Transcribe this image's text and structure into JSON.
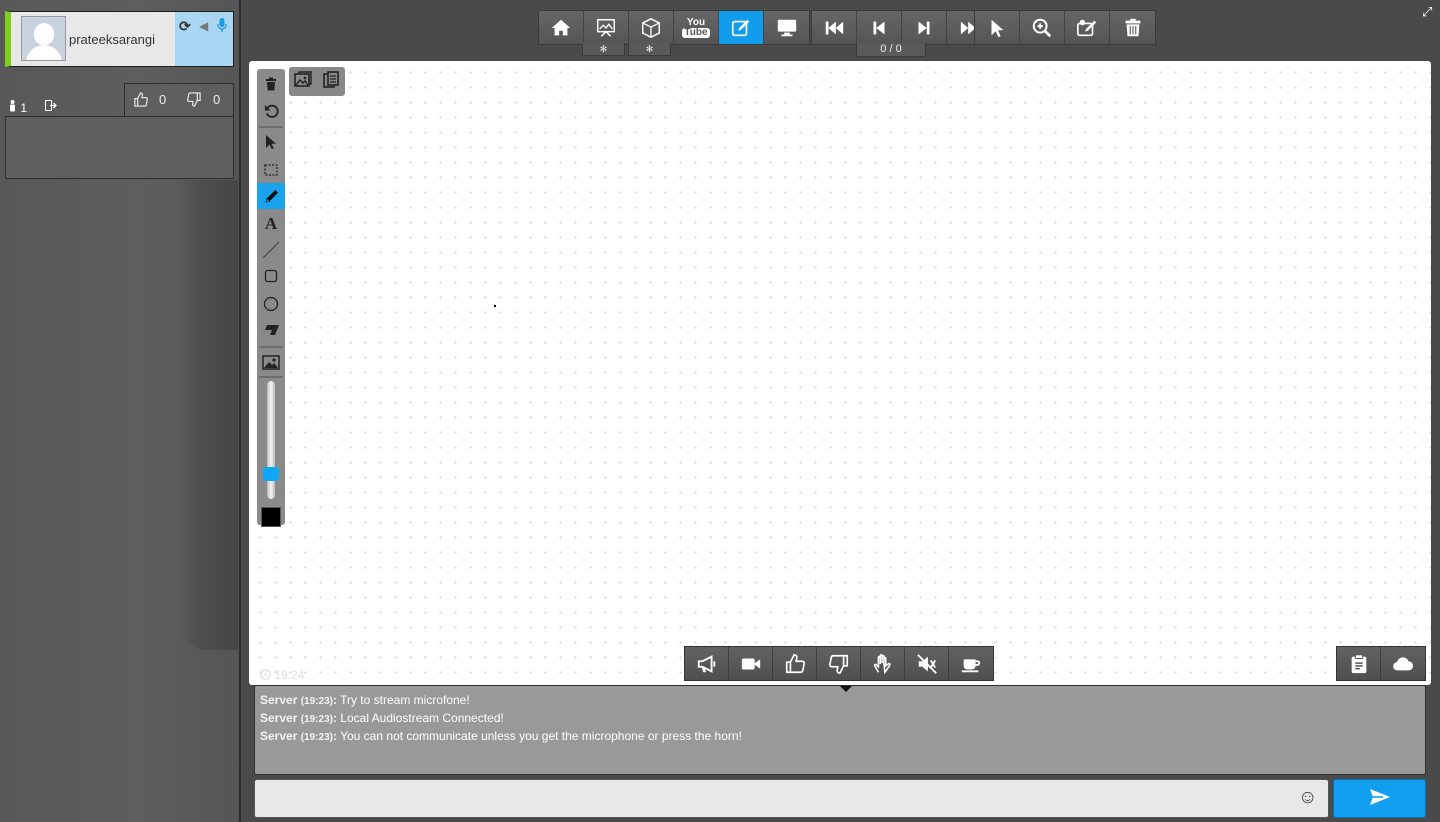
{
  "user_card": {
    "username": "prateeksarangi",
    "status_color": "#79d21a",
    "controls": [
      "refresh-icon",
      "speaker-icon",
      "microphone-icon"
    ]
  },
  "participants": {
    "count": "1"
  },
  "votes": {
    "up": "0",
    "down": "0"
  },
  "top_toolbar": {
    "groups": [
      [
        "home-icon",
        "presentation-icon",
        "3d-icon",
        "youtube-icon",
        "whiteboard-icon",
        "screen-share-icon"
      ],
      [
        "first-page-icon",
        "previous-page-icon",
        "next-page-icon",
        "last-page-icon"
      ],
      [
        "pointer-icon",
        "zoom-icon",
        "edit-board-icon",
        "trash-icon"
      ]
    ],
    "active": "whiteboard-icon",
    "youtube_label_top": "You",
    "youtube_label_bottom": "Tube",
    "page_counter": "0 / 0"
  },
  "draw_tools": {
    "tools": [
      "trash-icon",
      "undo-icon",
      "select-icon",
      "rect-select-icon",
      "pencil-icon",
      "text-icon",
      "line-icon",
      "rectangle-icon",
      "circle-icon",
      "eraser-icon",
      "image-icon"
    ],
    "active": "pencil-icon",
    "brush_size_fraction": 0.12,
    "brush_color": "#000000",
    "accent_color": "#1ba4ee"
  },
  "clock": {
    "time": "19:24"
  },
  "action_bar": {
    "buttons": [
      "megaphone-icon",
      "video-camera-icon",
      "thumbs-up-icon",
      "thumbs-down-icon",
      "raise-hand-icon",
      "mute-icon",
      "coffee-break-icon"
    ],
    "right_buttons": [
      "clipboard-icon",
      "cloud-icon"
    ]
  },
  "chat": {
    "messages": [
      {
        "sender": "Server",
        "time": "(19:23)",
        "text": "Try to stream microfone!"
      },
      {
        "sender": "Server",
        "time": "(19:23)",
        "text": "Local Audiostream Connected!"
      },
      {
        "sender": "Server",
        "time": "(19:23)",
        "text": "You can not communicate unless you get the microphone or press the horn!"
      }
    ],
    "input_value": "",
    "input_placeholder": ""
  }
}
